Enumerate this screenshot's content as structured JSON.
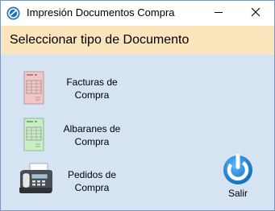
{
  "window": {
    "title": "Impresión Documentos Compra",
    "icons": {
      "app": "app-logo-icon",
      "minimize": "minimize-icon",
      "close": "close-icon"
    }
  },
  "header": {
    "title": "Seleccionar tipo de Documento"
  },
  "options": [
    {
      "line1": "Facturas de",
      "line2": "Compra",
      "icon": "invoice-document-icon",
      "color": "#f2c6c6"
    },
    {
      "line1": "Albaranes de",
      "line2": "Compra",
      "icon": "delivery-note-document-icon",
      "color": "#c9eec4"
    },
    {
      "line1": "Pedidos de",
      "line2": "Compra",
      "icon": "fax-machine-icon"
    }
  ],
  "exit": {
    "label": "Salir",
    "icon": "power-icon",
    "color": "#1a86d4"
  },
  "colors": {
    "header_band": "#fbe5bd",
    "body": "#d6e3f3",
    "accent": "#1a86d4"
  }
}
